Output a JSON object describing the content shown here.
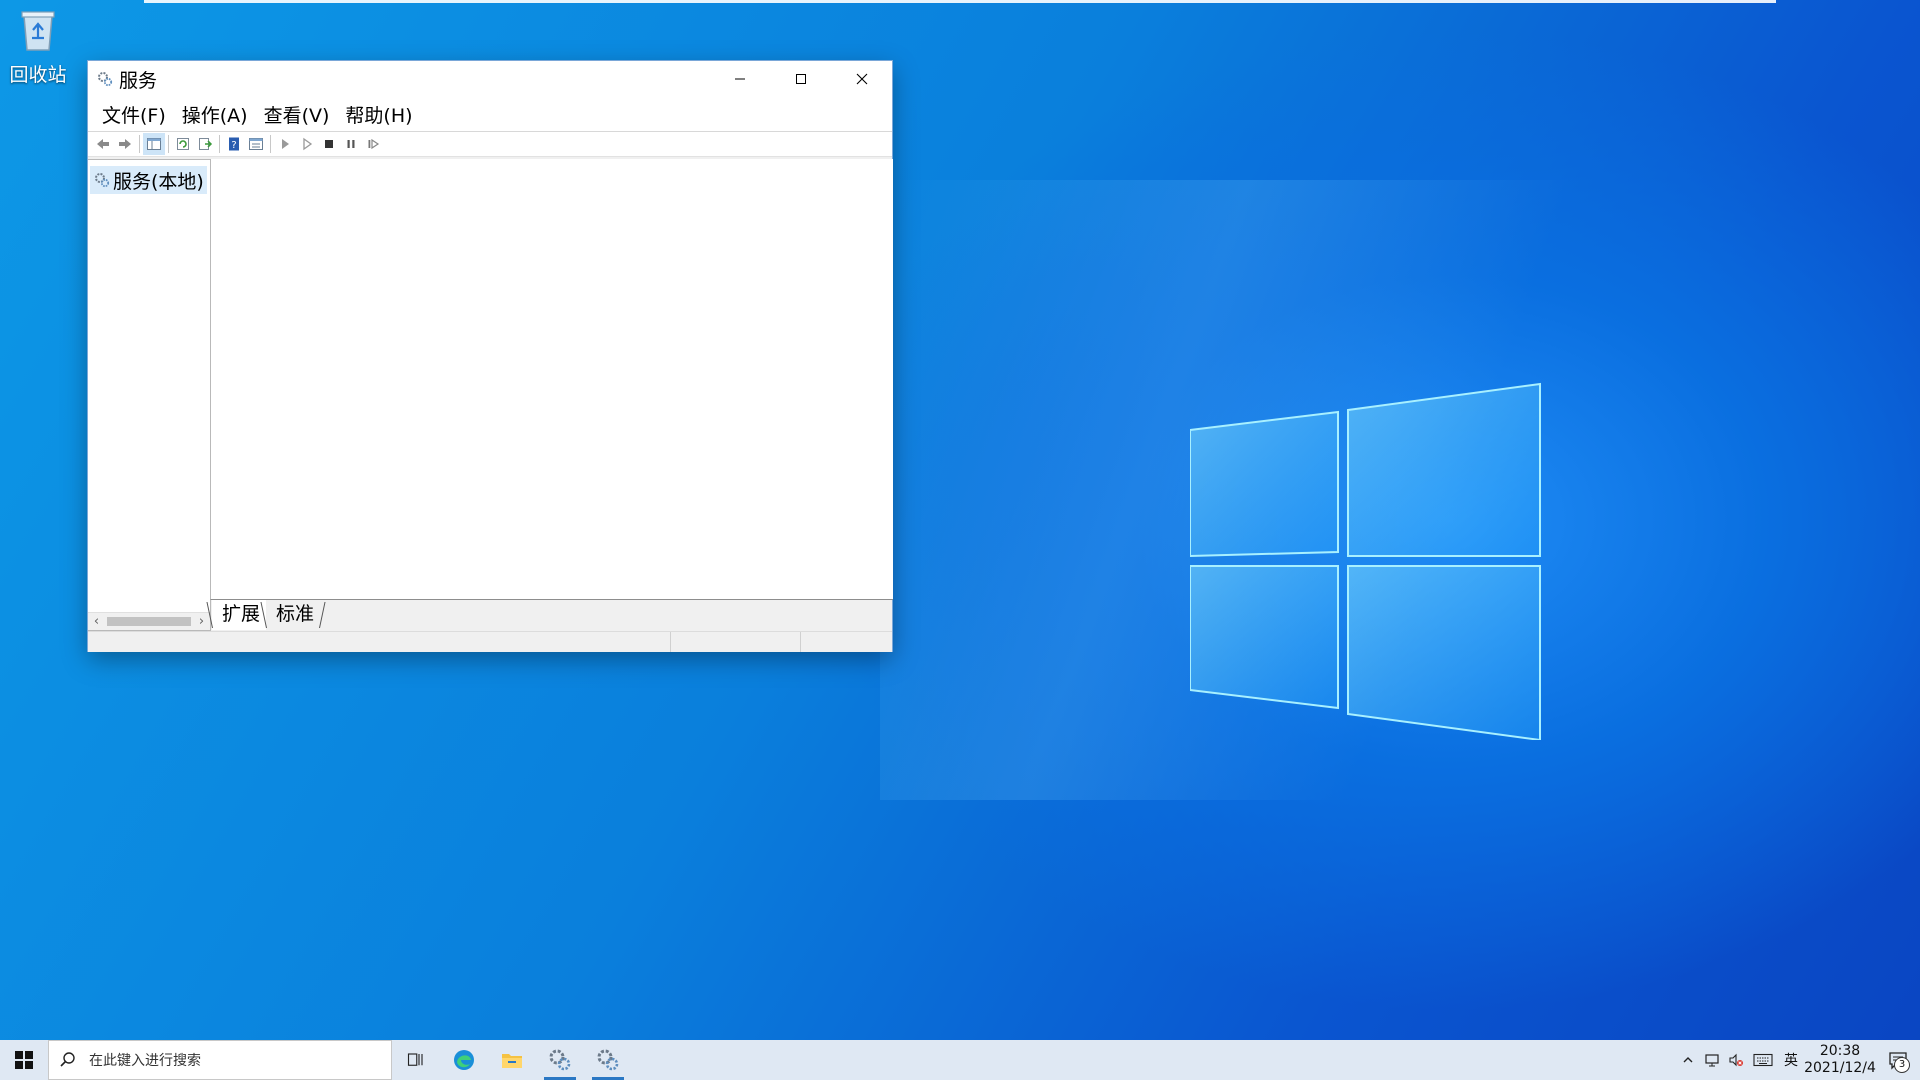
{
  "desktop": {
    "icons": [
      {
        "label": "回收站",
        "icon": "recycle-bin-icon"
      }
    ]
  },
  "window": {
    "title": "服务",
    "menu": [
      "文件(F)",
      "操作(A)",
      "查看(V)",
      "帮助(H)"
    ],
    "toolbar_icons": [
      "back-icon",
      "forward-icon",
      "show-hide-tree-icon",
      "refresh-icon",
      "export-list-icon",
      "help-icon",
      "properties-icon",
      "start-service-icon",
      "start-service-alt-icon",
      "stop-service-icon",
      "pause-service-icon",
      "resume-service-icon"
    ],
    "tree": {
      "selected_item": "服务(本地)"
    },
    "tabs": [
      "扩展",
      "标准"
    ],
    "active_tab": "扩展"
  },
  "taskbar": {
    "search_placeholder": "在此键入进行搜索",
    "pinned": [
      "task-view-icon",
      "edge-icon",
      "file-explorer-icon",
      "services-app-icon",
      "services-app-icon"
    ],
    "tray": {
      "input_method": "英",
      "time": "20:38",
      "date": "2021/12/4",
      "notification_count": "3"
    }
  },
  "colors": {
    "accent": "#0078d7",
    "selection": "#d9ebfa",
    "taskbar": "#dfe8f3"
  }
}
